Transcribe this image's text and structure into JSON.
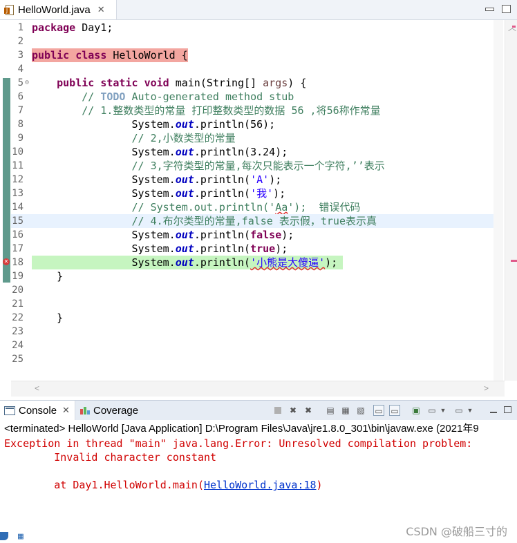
{
  "editor": {
    "tab_label": "HelloWorld.java",
    "tab_close": "✕",
    "lines": [
      {
        "n": "1",
        "html": "<span class='kw'>package</span> Day1;"
      },
      {
        "n": "2",
        "html": ""
      },
      {
        "n": "3",
        "html": "<span class='kw'>public</span> <span class='kw'>class</span> HelloWorld {"
      },
      {
        "n": "4",
        "html": ""
      },
      {
        "n": "5",
        "html": "    <span class='kw'>public</span> <span class='kw'>static</span> <span class='kw'>void</span> main(String[] <span class='par'>args</span>) {"
      },
      {
        "n": "6",
        "html": "        <span class='cmt'>// <span class='todo'>TODO</span> Auto-generated method stub</span>"
      },
      {
        "n": "7",
        "html": "        <span class='cmt'>// 1.整数类型的常量 打印整数类型的数据 56 ,将56称作常量</span>"
      },
      {
        "n": "8",
        "html": "                System.<span class='fld'>out</span>.println(56);"
      },
      {
        "n": "9",
        "html": "                <span class='cmt'>// 2,小数类型的常量</span>"
      },
      {
        "n": "10",
        "html": "                System.<span class='fld'>out</span>.println(3.24);"
      },
      {
        "n": "11",
        "html": "                <span class='cmt'>// 3,字符类型的常量,每次只能表示一个字符,’’表示</span>"
      },
      {
        "n": "12",
        "html": "                System.<span class='fld'>out</span>.println(<span class='str'>'A'</span>);"
      },
      {
        "n": "13",
        "html": "                System.<span class='fld'>out</span>.println(<span class='str'>'我'</span>);"
      },
      {
        "n": "14",
        "html": "                <span class='cmt'>// System.out.println('<span class='squiggle'>Aa</span>');  错误代码</span>"
      },
      {
        "n": "15",
        "html": "                <span class='cmt'>// 4.布尔类型的常量,false 表示假，true表示真</span>"
      },
      {
        "n": "16",
        "html": "                System.<span class='fld'>out</span>.println(<span class='kw'>false</span>);"
      },
      {
        "n": "17",
        "html": "                System.<span class='fld'>out</span>.println(<span class='kw'>true</span>);"
      },
      {
        "n": "18",
        "html": "                System.<span class='fld'>out</span>.println(<span class='str squiggle'>'小熊是大傻逼'</span>);"
      },
      {
        "n": "19",
        "html": "    }"
      },
      {
        "n": "20",
        "html": ""
      },
      {
        "n": "21",
        "html": ""
      },
      {
        "n": "22",
        "html": "    }"
      },
      {
        "n": "23",
        "html": ""
      },
      {
        "n": "24",
        "html": ""
      },
      {
        "n": "25",
        "html": ""
      }
    ],
    "highlight_colors": {
      "class_decl": "#f3a6a0",
      "current_line": "#e8f2fe",
      "run_line": "#c6f5c0"
    }
  },
  "console": {
    "tab_label": "Console",
    "tab_close": "✕",
    "coverage_label": "Coverage",
    "terminated": "<terminated> HelloWorld [Java Application] D:\\Program Files\\Java\\jre1.8.0_301\\bin\\javaw.exe (2021年9",
    "exception_line": "Exception in thread \"main\" java.lang.Error: Unresolved compilation problem: ",
    "detail_line": "        Invalid character constant",
    "at_prefix": "        at Day1.HelloWorld.main(",
    "at_link": "HelloWorld.java:18",
    "at_suffix": ")"
  },
  "watermark": "CSDN @破船三寸的"
}
